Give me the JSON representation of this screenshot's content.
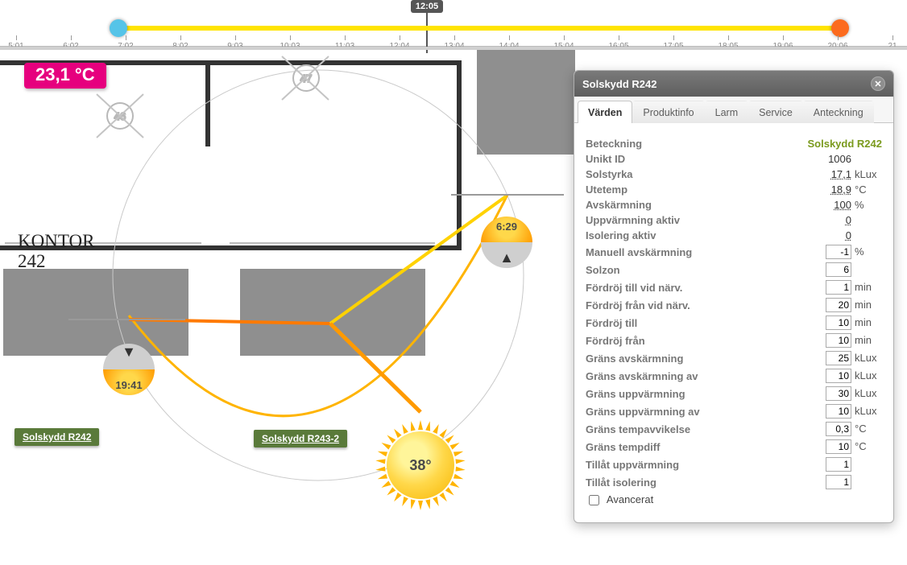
{
  "timeline": {
    "flag": "12:05",
    "ticks": [
      "5:01",
      "6:02",
      "7:02",
      "8:02",
      "9:03",
      "10:03",
      "11:03",
      "12:04",
      "13:04",
      "14:04",
      "15:04",
      "16:05",
      "17:05",
      "18:05",
      "19:06",
      "20:06",
      "21"
    ]
  },
  "badge": {
    "temp": "23,1 °C"
  },
  "room": {
    "name": "KONTOR",
    "number": "242"
  },
  "devices": {
    "a": "Solskydd R242",
    "b": "Solskydd R243-2"
  },
  "sun": {
    "elevation": "38°",
    "sunrise": "6:29",
    "sunset": "19:41"
  },
  "floorplan": {
    "compass47": "47",
    "compass46": "46"
  },
  "panel": {
    "title": "Solskydd R242",
    "tabs": [
      "Värden",
      "Produktinfo",
      "Larm",
      "Service",
      "Anteckning"
    ],
    "rows": [
      {
        "k": "Beteckning",
        "v": "Solskydd R242",
        "unit": "",
        "brand": true
      },
      {
        "k": "Unikt ID",
        "v": "1006",
        "unit": ""
      },
      {
        "k": "Solstyrka",
        "v": "17,1",
        "unit": "kLux",
        "link": true
      },
      {
        "k": "Utetemp",
        "v": "18,9",
        "unit": "°C",
        "link": true
      },
      {
        "k": "Avskärmning",
        "v": "100",
        "unit": "%",
        "link": true
      },
      {
        "k": "Uppvärmning aktiv",
        "v": "0",
        "unit": "",
        "link": true
      },
      {
        "k": "Isolering aktiv",
        "v": "0",
        "unit": "",
        "link": true
      },
      {
        "k": "Manuell avskärmning",
        "v": "-1",
        "unit": "%",
        "edit": true
      },
      {
        "k": "Solzon",
        "v": "6",
        "unit": "",
        "edit": true
      },
      {
        "k": "Fördröj till vid närv.",
        "v": "1",
        "unit": "min",
        "edit": true
      },
      {
        "k": "Fördröj från vid närv.",
        "v": "20",
        "unit": "min",
        "edit": true
      },
      {
        "k": "Fördröj till",
        "v": "10",
        "unit": "min",
        "edit": true
      },
      {
        "k": "Fördröj från",
        "v": "10",
        "unit": "min",
        "edit": true
      },
      {
        "k": "Gräns avskärmning",
        "v": "25",
        "unit": "kLux",
        "edit": true
      },
      {
        "k": "Gräns avskärmning av",
        "v": "10",
        "unit": "kLux",
        "edit": true
      },
      {
        "k": "Gräns uppvärmning",
        "v": "30",
        "unit": "kLux",
        "edit": true
      },
      {
        "k": "Gräns uppvärmning av",
        "v": "10",
        "unit": "kLux",
        "edit": true
      },
      {
        "k": "Gräns tempavvikelse",
        "v": "0,3",
        "unit": "°C",
        "edit": true
      },
      {
        "k": "Gräns tempdiff",
        "v": "10",
        "unit": "°C",
        "edit": true
      },
      {
        "k": "Tillåt uppvärmning",
        "v": "1",
        "unit": "",
        "edit": true
      },
      {
        "k": "Tillåt isolering",
        "v": "1",
        "unit": "",
        "edit": true
      }
    ],
    "advanced": "Avancerat"
  }
}
